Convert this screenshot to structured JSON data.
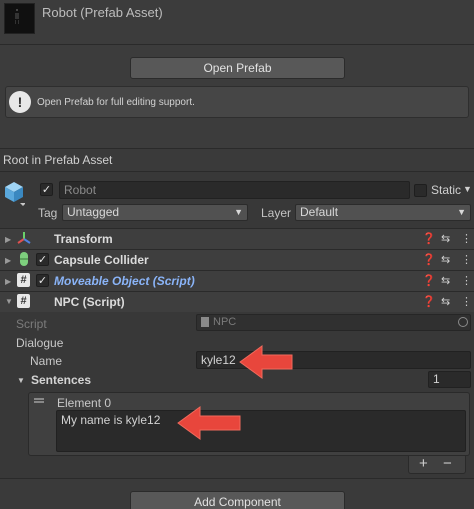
{
  "header": {
    "asset_title": "Robot (Prefab Asset)",
    "open_prefab_label": "Open Prefab",
    "info_message": "Open Prefab for full editing support."
  },
  "section": {
    "label": "Root in Prefab Asset"
  },
  "gameobject": {
    "active": true,
    "name": "Robot",
    "static_label": "Static",
    "tag_label": "Tag",
    "tag_value": "Untagged",
    "layer_label": "Layer",
    "layer_value": "Default"
  },
  "components": [
    {
      "name": "Transform",
      "has_checkbox": false
    },
    {
      "name": "Capsule Collider",
      "has_checkbox": true
    },
    {
      "name": "Moveable Object (Script)",
      "has_checkbox": true
    },
    {
      "name": "NPC (Script)",
      "has_checkbox": false
    }
  ],
  "npc": {
    "script_label": "Script",
    "script_value": "NPC",
    "dialogue_label": "Dialogue",
    "name_label": "Name",
    "name_value": "kyle12",
    "sentences_label": "Sentences",
    "sentences_count": "1",
    "element_label": "Element 0",
    "element_value": "My name is kyle12",
    "add_label": "+",
    "remove_label": "−"
  },
  "footer": {
    "add_component_label": "Add Component"
  },
  "colors": {
    "background": "#383838",
    "highlight_blue": "#8ab4f8",
    "arrow_red": "#e8463c"
  },
  "icons": {
    "info": "exclamation-icon",
    "help": "question-icon",
    "presets": "sliders-icon",
    "menu": "kebab-icon"
  }
}
